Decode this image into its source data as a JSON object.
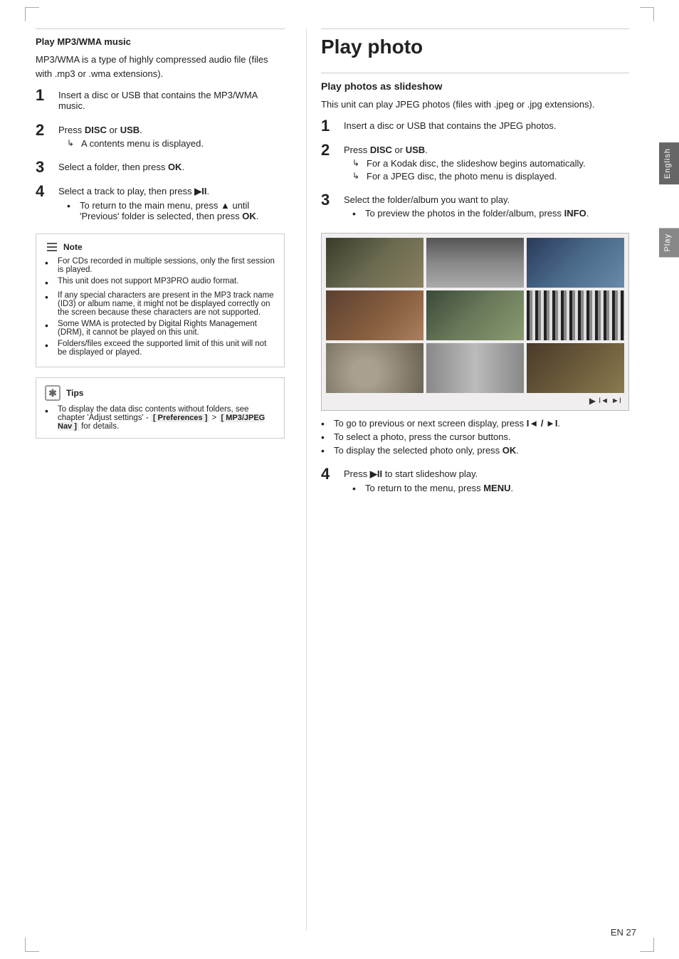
{
  "page": {
    "number": "EN  27",
    "side_label_english": "English",
    "side_label_play": "Play"
  },
  "left": {
    "section_title": "Play MP3/WMA music",
    "intro_text": "MP3/WMA is a type of highly compressed audio file (files with .mp3 or .wma extensions).",
    "steps": [
      {
        "num": "1",
        "text": "Insert a disc or USB that contains the MP3/WMA music."
      },
      {
        "num": "2",
        "text_before": "Press ",
        "bold_words": "DISC or USB",
        "text_after": ".",
        "sub": [
          {
            "arrow": true,
            "text": "A contents menu is displayed."
          }
        ]
      },
      {
        "num": "3",
        "text_before": "Select a folder, then press ",
        "bold_words": "OK",
        "text_after": "."
      },
      {
        "num": "4",
        "text_before": "Select a track to play, then press ",
        "bold_symbol": "▶II",
        "text_after": ".",
        "sub": [
          {
            "arrow": false,
            "text": "To return to the main menu, press ▲ until 'Previous' folder is selected, then press OK."
          }
        ]
      }
    ],
    "note": {
      "header": "Note",
      "items": [
        "For CDs recorded in multiple sessions, only the first session is played.",
        "This unit does not support MP3PRO audio format.",
        "If any special characters are present in the MP3 track name (ID3) or album name, it might not be displayed correctly on the screen because these characters are not supported.",
        "Some WMA is protected by Digital Rights Management (DRM), it cannot be played on this unit.",
        "Folders/files exceed the supported limit of this unit will not be displayed or played."
      ]
    },
    "tips": {
      "header": "Tips",
      "items": [
        "To display the data disc contents without folders, see chapter 'Adjust settings' - [ Preferences ] > [ MP3/JPEG Nav ] for details."
      ]
    }
  },
  "right": {
    "big_title": "Play photo",
    "sub_title": "Play photos as slideshow",
    "intro_text": "This unit can play JPEG photos (files with .jpeg or .jpg extensions).",
    "steps": [
      {
        "num": "1",
        "text": "Insert a disc or USB that contains the JPEG photos."
      },
      {
        "num": "2",
        "text_before": "Press ",
        "bold_words": "DISC or USB",
        "text_after": ".",
        "sub": [
          {
            "arrow": true,
            "text": "For a Kodak disc, the slideshow begins automatically."
          },
          {
            "arrow": true,
            "text": "For a JPEG disc, the photo menu is displayed."
          }
        ]
      },
      {
        "num": "3",
        "text": "Select the folder/album you want to play.",
        "sub": [
          {
            "arrow": false,
            "text": "To preview the photos in the folder/album, press INFO."
          }
        ]
      },
      {
        "num": "4",
        "text_before": "Press ",
        "bold_symbol": "▶II",
        "text_after": " to start slideshow play.",
        "sub": [
          {
            "arrow": false,
            "text": "To return to the menu, press MENU."
          }
        ]
      }
    ],
    "photo_grid": {
      "nav_icons": "► ◄ ►",
      "nav_text": "► I◄ / ►I"
    },
    "bullets_after_grid": [
      "To go to previous or next screen display, press I◄ / ►I.",
      "To select a photo, press the cursor buttons.",
      "To display the selected photo only, press OK."
    ]
  }
}
